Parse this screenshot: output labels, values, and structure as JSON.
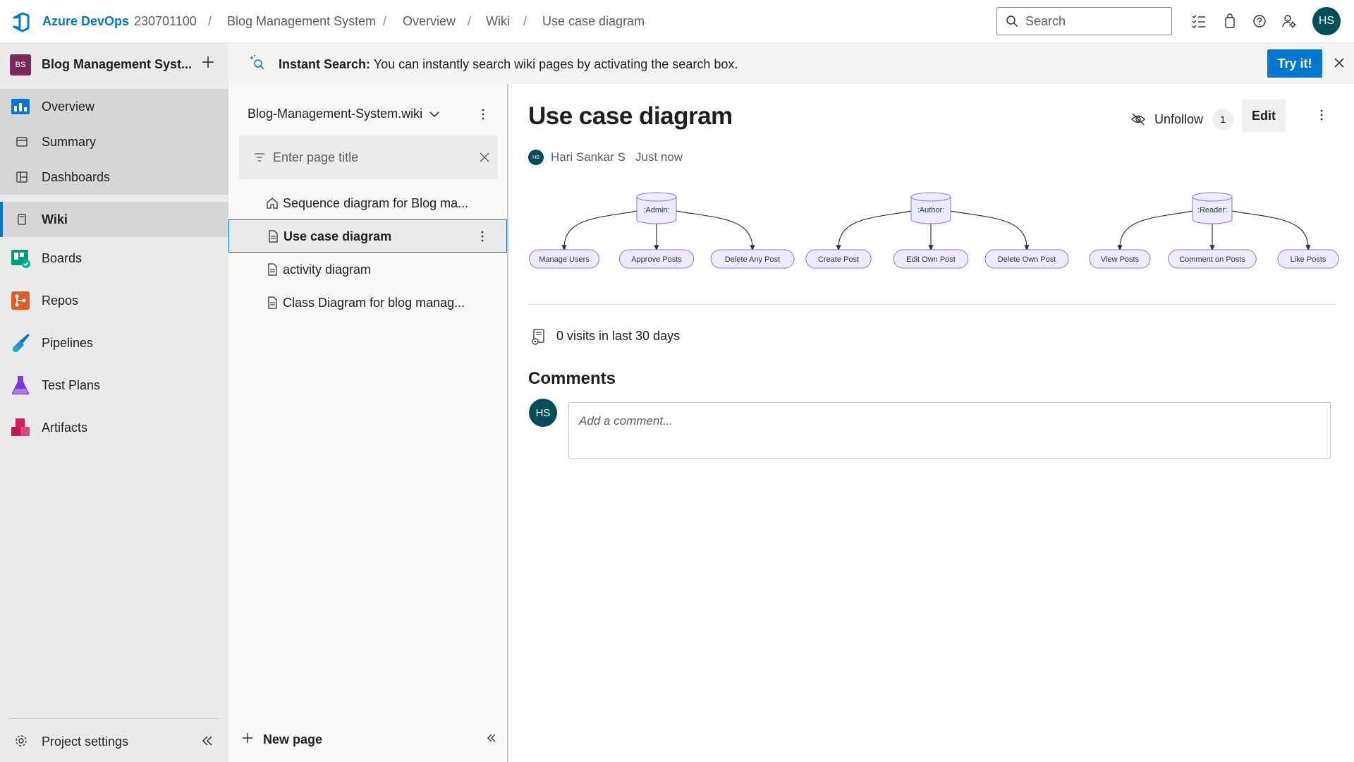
{
  "header": {
    "brand": "Azure DevOps",
    "org": "230701100",
    "breadcrumbs": [
      "Blog Management System",
      "Overview",
      "Wiki",
      "Use case diagram"
    ],
    "search_placeholder": "Search",
    "avatar_initials": "HS"
  },
  "sidebar": {
    "project_badge": "BS",
    "project_name": "Blog Management Syst...",
    "items": [
      {
        "label": "Overview",
        "icon": "overview-icon"
      },
      {
        "label": "Summary",
        "icon": "summary-icon"
      },
      {
        "label": "Dashboards",
        "icon": "dashboards-icon"
      },
      {
        "label": "Wiki",
        "icon": "wiki-icon"
      },
      {
        "label": "Boards",
        "icon": "boards-icon"
      },
      {
        "label": "Repos",
        "icon": "repos-icon"
      },
      {
        "label": "Pipelines",
        "icon": "pipelines-icon"
      },
      {
        "label": "Test Plans",
        "icon": "test-plans-icon"
      },
      {
        "label": "Artifacts",
        "icon": "artifacts-icon"
      }
    ],
    "selected": "Wiki",
    "settings_label": "Project settings"
  },
  "banner": {
    "bold": "Instant Search:",
    "text": " You can instantly search wiki pages by activating the search box.",
    "button": "Try it!"
  },
  "wiki_tree": {
    "wiki_name": "Blog-Management-System.wiki",
    "filter_placeholder": "Enter page title",
    "pages": [
      {
        "label": "Sequence diagram for Blog ma...",
        "icon": "home-icon"
      },
      {
        "label": "Use case diagram",
        "icon": "page-icon"
      },
      {
        "label": "activity diagram",
        "icon": "page-icon"
      },
      {
        "label": "Class Diagram for blog manag...",
        "icon": "page-icon"
      }
    ],
    "active_page": "Use case diagram",
    "new_page": "New page"
  },
  "page": {
    "title": "Use case diagram",
    "unfollow_label": "Unfollow",
    "follow_count": "1",
    "edit_label": "Edit",
    "author_initials": "HS",
    "author": "Hari Sankar S",
    "time": "Just now",
    "visits": "0 visits in last 30 days",
    "comments_title": "Comments",
    "comment_placeholder": "Add a comment...",
    "comment_avatar": "HS"
  },
  "diagram": {
    "actors": [
      {
        "name": ":Admin:",
        "use_cases": [
          "Manage Users",
          "Approve Posts",
          "Delete Any Post"
        ]
      },
      {
        "name": ":Author:",
        "use_cases": [
          "Create Post",
          "Edit Own Post",
          "Delete Own Post"
        ]
      },
      {
        "name": ":Reader:",
        "use_cases": [
          "View Posts",
          "Comment on Posts",
          "Like Posts"
        ]
      }
    ],
    "node_fill": "#ececff",
    "node_stroke": "#9370db"
  },
  "colors": {
    "accent": "#0078d4",
    "project_badge": "#7b2a58",
    "avatar": "#004e5a"
  }
}
